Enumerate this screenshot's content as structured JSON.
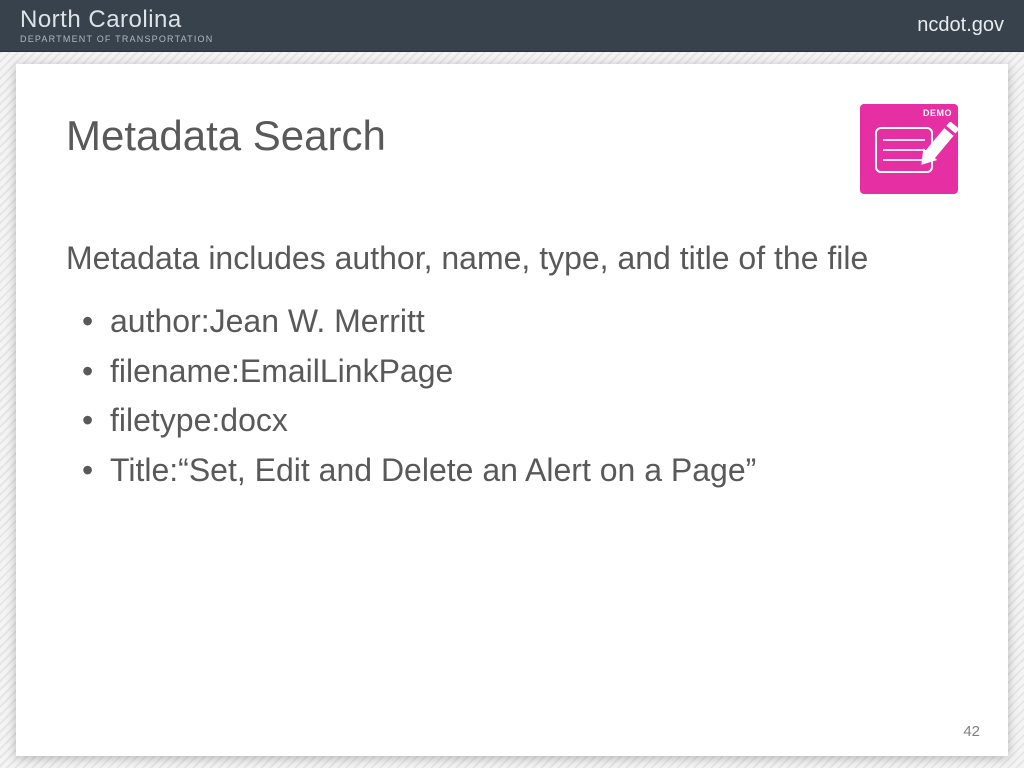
{
  "header": {
    "state": "North Carolina",
    "department": "DEPARTMENT OF TRANSPORTATION",
    "site": "ncdot.gov"
  },
  "badge": {
    "label": "DEMO"
  },
  "slide": {
    "title": "Metadata Search",
    "intro": "Metadata includes author, name, type, and title of the file",
    "bullets": [
      "author:Jean W. Merritt",
      "filename:EmailLinkPage",
      "filetype:docx",
      "Title:“Set, Edit and Delete an Alert on a Page”"
    ],
    "page_number": "42"
  }
}
